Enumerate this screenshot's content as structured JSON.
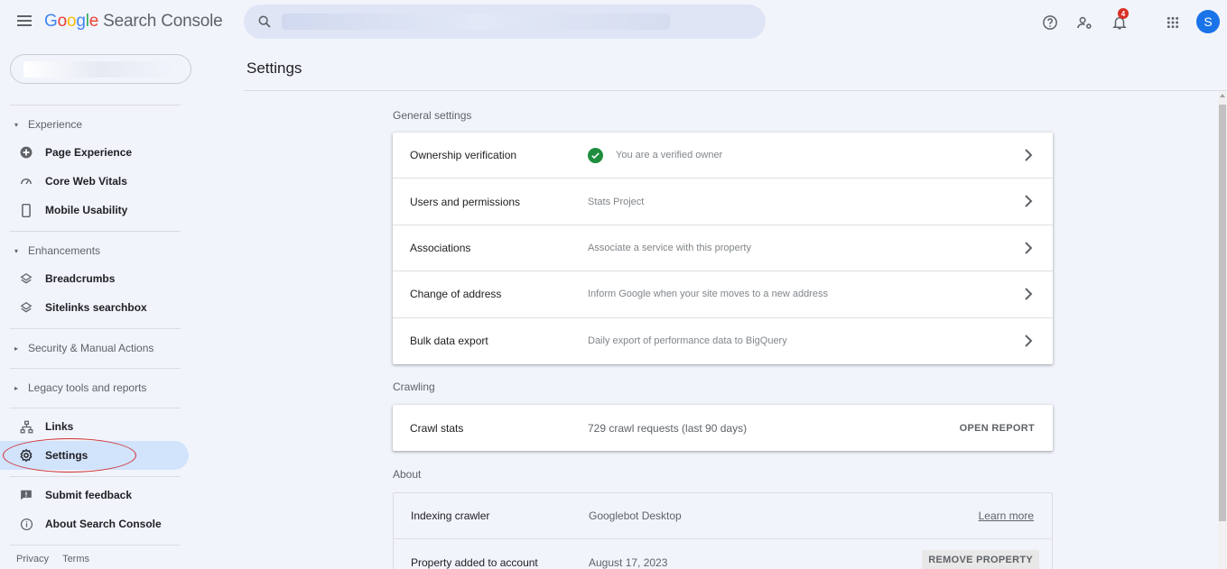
{
  "app": {
    "logo_letters": [
      "G",
      "o",
      "o",
      "g",
      "l",
      "e"
    ],
    "product_name": "Search Console",
    "notification_count": "4",
    "avatar_initial": "S"
  },
  "search": {
    "placeholder": ""
  },
  "page": {
    "title": "Settings"
  },
  "sidebar": {
    "sections": {
      "experience": "Experience",
      "enhancements": "Enhancements",
      "security": "Security & Manual Actions",
      "legacy": "Legacy tools and reports"
    },
    "items": {
      "page_experience": "Page Experience",
      "core_web_vitals": "Core Web Vitals",
      "mobile_usability": "Mobile Usability",
      "breadcrumbs": "Breadcrumbs",
      "sitelinks_searchbox": "Sitelinks searchbox",
      "links": "Links",
      "settings": "Settings",
      "submit_feedback": "Submit feedback",
      "about": "About Search Console"
    },
    "footer": {
      "privacy": "Privacy",
      "terms": "Terms"
    }
  },
  "general": {
    "title": "General settings",
    "rows": [
      {
        "label": "Ownership verification",
        "value": "You are a verified owner"
      },
      {
        "label": "Users and permissions",
        "value": "Stats Project"
      },
      {
        "label": "Associations",
        "value": "Associate a service with this property"
      },
      {
        "label": "Change of address",
        "value": "Inform Google when your site moves to a new address"
      },
      {
        "label": "Bulk data export",
        "value": "Daily export of performance data to BigQuery"
      }
    ]
  },
  "crawling": {
    "title": "Crawling",
    "label": "Crawl stats",
    "value": "729 crawl requests (last 90 days)",
    "action": "OPEN REPORT"
  },
  "about": {
    "title": "About",
    "rows": [
      {
        "label": "Indexing crawler",
        "value": "Googlebot Desktop",
        "action": "Learn more"
      },
      {
        "label": "Property added to account",
        "value": "August 17, 2023",
        "action": "REMOVE PROPERTY"
      }
    ]
  },
  "colors": {
    "accent": "#1a73e8",
    "active_nav": "#d2e3fc",
    "verified": "#1e8e3e",
    "badge": "#d93025"
  }
}
